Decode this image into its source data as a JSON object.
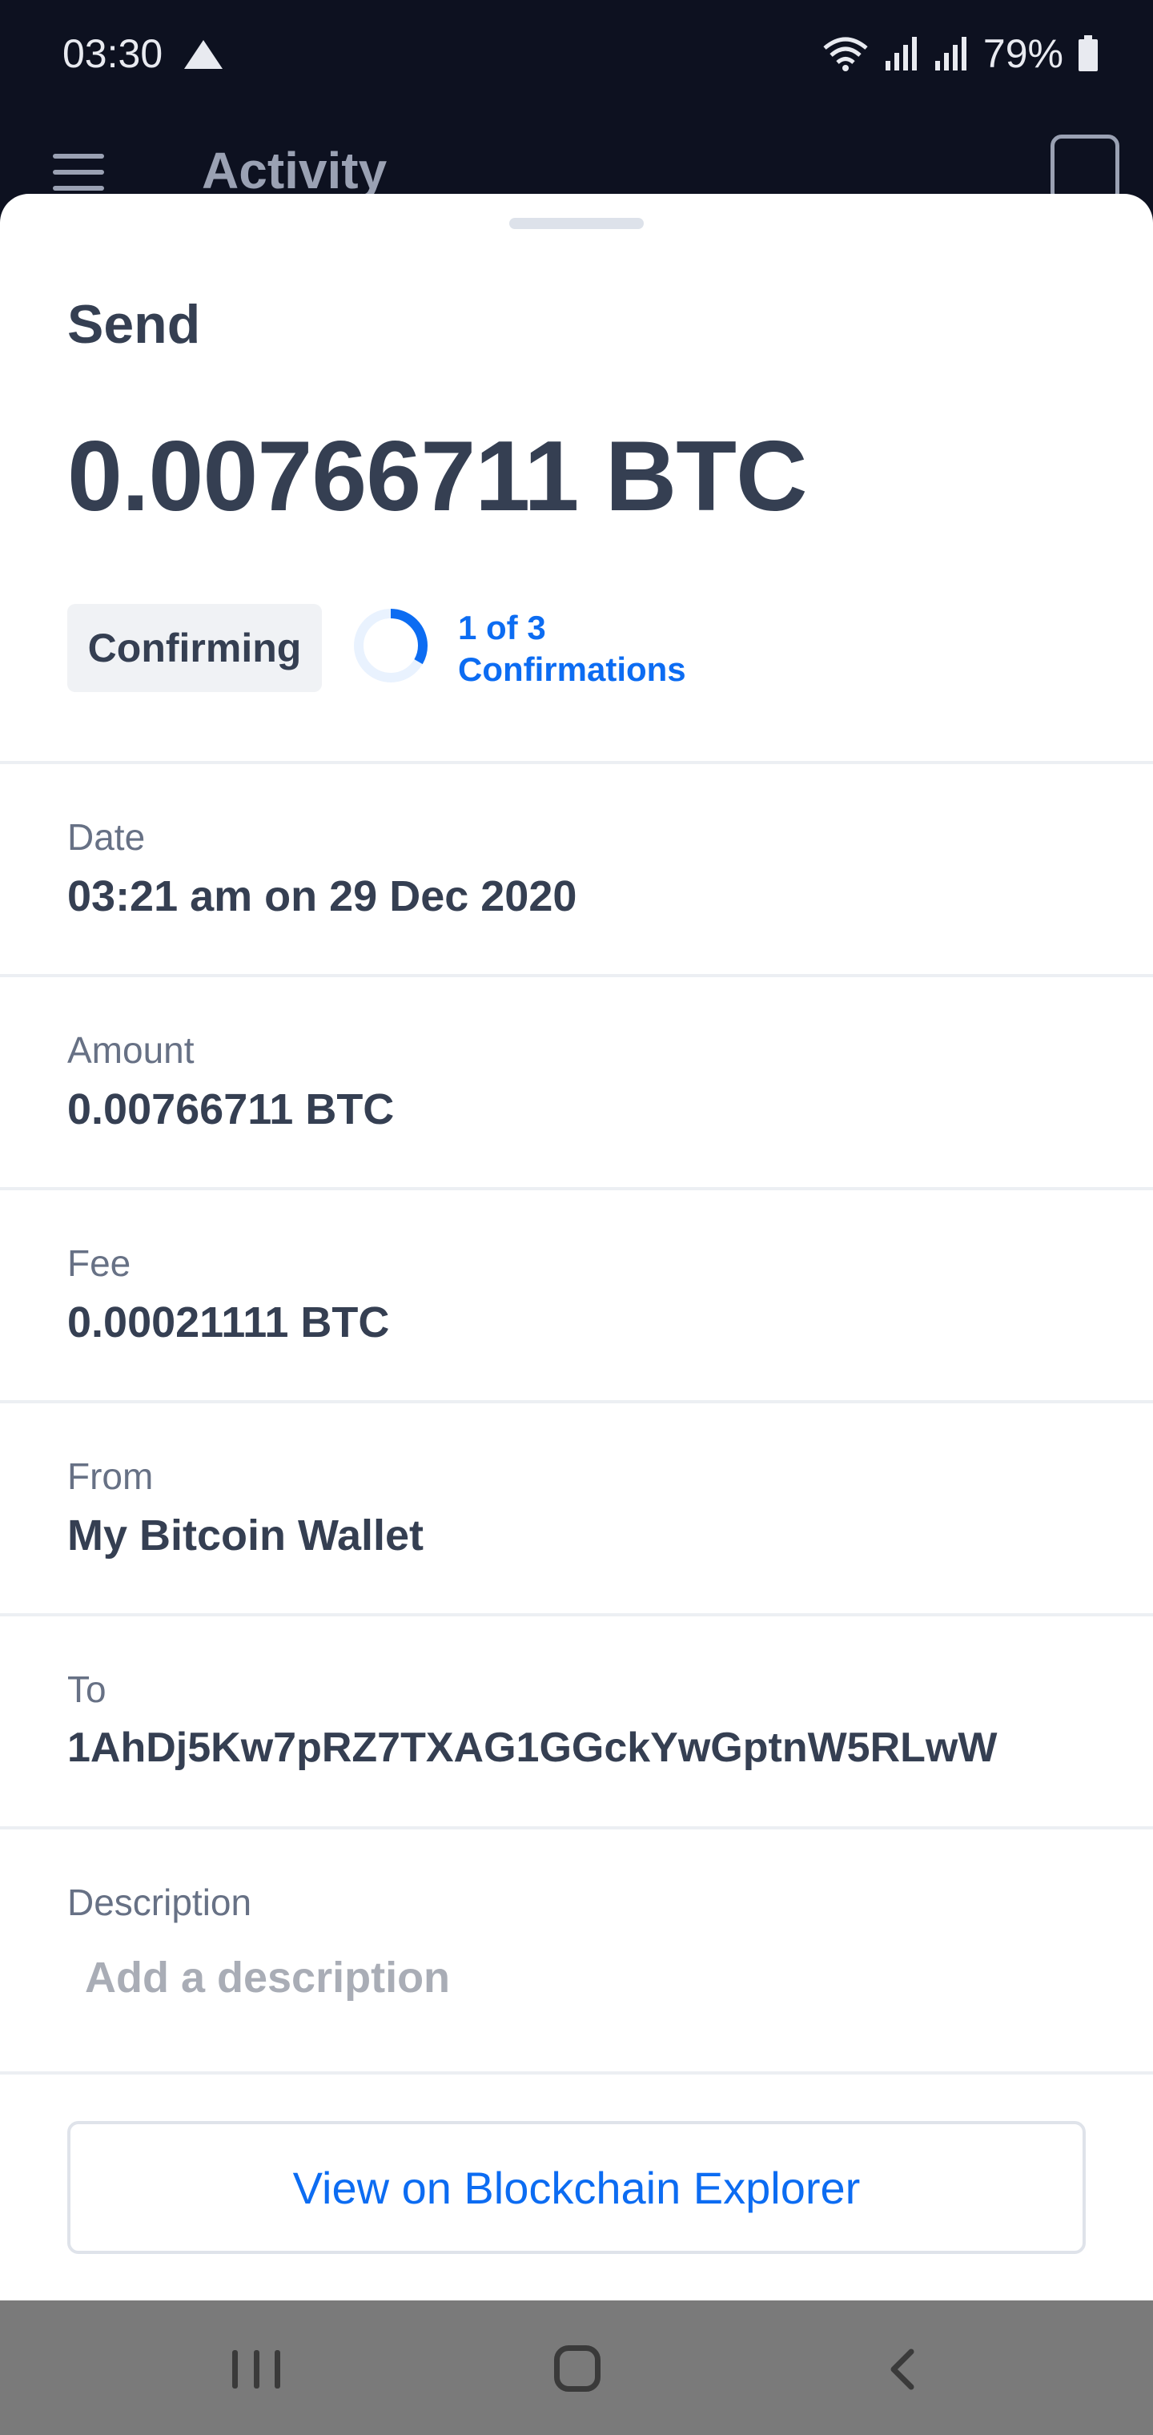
{
  "status_bar": {
    "time": "03:30",
    "battery": "79%"
  },
  "app_header": {
    "title": "Activity"
  },
  "transaction": {
    "type": "Send",
    "amount_display": "0.00766711 BTC",
    "status": "Confirming",
    "confirmations_line1": "1 of 3",
    "confirmations_line2": "Confirmations",
    "confirmations_done": 1,
    "confirmations_required": 3
  },
  "details": {
    "date_label": "Date",
    "date_value": "03:21 am on 29 Dec 2020",
    "amount_label": "Amount",
    "amount_value": "0.00766711 BTC",
    "fee_label": "Fee",
    "fee_value": "0.00021111 BTC",
    "from_label": "From",
    "from_value": "My Bitcoin Wallet",
    "to_label": "To",
    "to_value": "1AhDj5Kw7pRZ7TXAG1GGckYwGptnW5RLwW",
    "description_label": "Description",
    "description_placeholder": "Add a description"
  },
  "actions": {
    "explorer_button": "View on Blockchain Explorer"
  },
  "colors": {
    "accent": "#0c6cf2",
    "text_primary": "#353f52",
    "text_secondary": "#677185",
    "header_bg": "#0d1120"
  },
  "icons": {
    "menu": "hamburger-menu-icon",
    "qr": "qr-code-icon",
    "nav_recent": "recent-apps-icon",
    "nav_home": "home-icon",
    "nav_back": "back-icon"
  }
}
